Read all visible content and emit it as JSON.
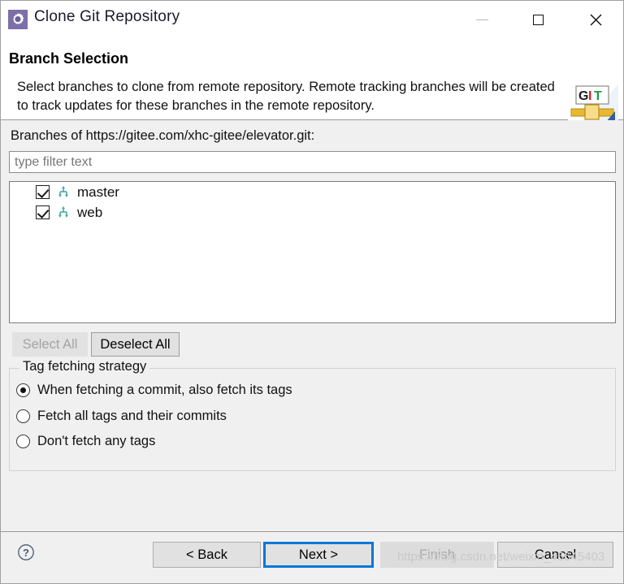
{
  "window": {
    "title": "Clone Git Repository",
    "icon": "gear-icon",
    "controls": {
      "minimize": "minimize-icon",
      "maximize": "maximize-icon",
      "close": "close-icon"
    }
  },
  "header": {
    "title": "Branch Selection",
    "description": "Select branches to clone from remote repository. Remote tracking branches will be created to track updates for these branches in the remote repository.",
    "logo": {
      "name": "git-logo",
      "text": "GIT",
      "letter_colors": [
        "#1b1b1b",
        "#d41f1f",
        "#1e9d3c"
      ]
    }
  },
  "main": {
    "branches_label": "Branches of https://gitee.com/xhc-gitee/elevator.git:",
    "filter": {
      "placeholder": "type filter text",
      "value": ""
    },
    "branches": [
      {
        "name": "master",
        "checked": true,
        "icon": "branch-icon"
      },
      {
        "name": "web",
        "checked": true,
        "icon": "branch-icon"
      }
    ],
    "select_all_label": "Select All",
    "select_all_enabled": false,
    "deselect_all_label": "Deselect All",
    "deselect_all_enabled": true,
    "tag_group": {
      "legend": "Tag fetching strategy",
      "options": [
        {
          "label": "When fetching a commit, also fetch its tags",
          "selected": true
        },
        {
          "label": "Fetch all tags and their commits",
          "selected": false
        },
        {
          "label": "Don't fetch any tags",
          "selected": false
        }
      ]
    }
  },
  "footer": {
    "help_icon": "help-icon",
    "back_label": "< Back",
    "next_label": "Next >",
    "finish_label": "Finish",
    "finish_enabled": false,
    "cancel_label": "Cancel",
    "focused_button": "Next >",
    "accent_color": "#0078d7"
  },
  "watermark": "https://blog.csdn.net/weixin_45645403"
}
